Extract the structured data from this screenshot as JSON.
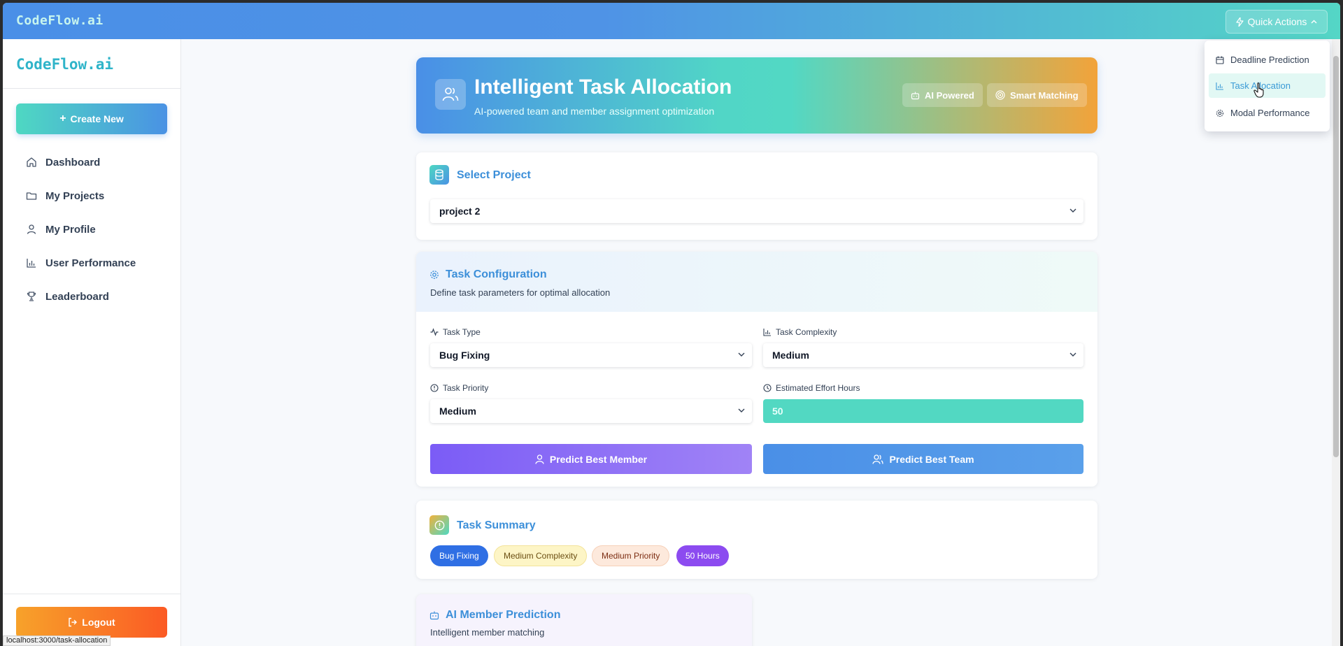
{
  "topbar": {
    "brand": "CodeFlow.ai",
    "quick_actions": "Quick Actions"
  },
  "sidebar": {
    "logo": "CodeFlow.ai",
    "create_label": "Create New",
    "items": [
      {
        "label": "Dashboard",
        "icon": "home-icon"
      },
      {
        "label": "My Projects",
        "icon": "folder-icon"
      },
      {
        "label": "My Profile",
        "icon": "user-icon"
      },
      {
        "label": "User Performance",
        "icon": "bar-chart-icon"
      },
      {
        "label": "Leaderboard",
        "icon": "trophy-icon"
      }
    ],
    "logout_label": "Logout"
  },
  "status_url": "localhost:3000/task-allocation",
  "hero": {
    "title": "Intelligent Task Allocation",
    "subtitle": "AI-powered team and member assignment optimization",
    "badges": [
      "AI Powered",
      "Smart Matching"
    ]
  },
  "select_project": {
    "title": "Select Project",
    "value": "project 2"
  },
  "task_config": {
    "title": "Task Configuration",
    "subtitle": "Define task parameters for optimal allocation",
    "task_type_label": "Task Type",
    "task_type_value": "Bug Fixing",
    "complexity_label": "Task Complexity",
    "complexity_value": "Medium",
    "priority_label": "Task Priority",
    "priority_value": "Medium",
    "effort_label": "Estimated Effort Hours",
    "effort_value": "50",
    "predict_member": "Predict Best Member",
    "predict_team": "Predict Best Team"
  },
  "task_summary": {
    "title": "Task Summary",
    "badges": [
      "Bug Fixing",
      "Medium Complexity",
      "Medium Priority",
      "50 Hours"
    ]
  },
  "member_prediction": {
    "title": "AI Member Prediction",
    "subtitle": "Intelligent member matching"
  },
  "quick_menu": {
    "items": [
      {
        "label": "Deadline Prediction",
        "icon": "calendar-icon"
      },
      {
        "label": "Task Allocation",
        "icon": "bar-chart-icon"
      },
      {
        "label": "Modal Performance",
        "icon": "gear-icon"
      }
    ]
  },
  "colors": {
    "accent_blue": "#4a8fe7",
    "accent_teal": "#4ed8c2",
    "accent_orange": "#fb5a24",
    "purple": "#7c5cf7"
  }
}
